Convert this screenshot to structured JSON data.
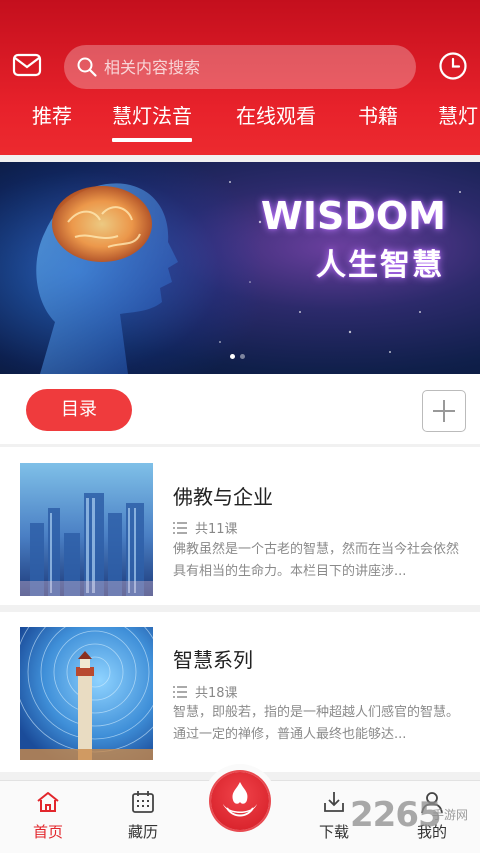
{
  "header": {
    "search_placeholder": "相关内容搜索",
    "tabs": [
      {
        "label": "推荐"
      },
      {
        "label": "慧灯法音"
      },
      {
        "label": "在线观看"
      },
      {
        "label": "书籍"
      },
      {
        "label": "慧灯"
      }
    ],
    "active_tab": "慧灯法音",
    "accent_color": "#e8222b"
  },
  "banner": {
    "title": "WISDOM",
    "subtitle": "人生智慧",
    "slide_count": 2,
    "active_slide": 1
  },
  "directory": {
    "button_label": "目录"
  },
  "courses": [
    {
      "title": "佛教与企业",
      "count": "共11课",
      "description": "佛教虽然是一个古老的智慧，然而在当今社会依然具有相当的生命力。本栏目下的讲座涉..."
    },
    {
      "title": "智慧系列",
      "count": "共18课",
      "description": "智慧，即般若，指的是一种超越人们感官的智慧。通过一定的禅修，普通人最终也能够达..."
    }
  ],
  "bottom_nav": {
    "items": [
      {
        "label": "首页"
      },
      {
        "label": "藏历"
      },
      {
        "label": "下载"
      },
      {
        "label": "我的"
      }
    ],
    "active": "首页"
  },
  "watermark": {
    "text": "2265",
    "sub": "手游网"
  }
}
